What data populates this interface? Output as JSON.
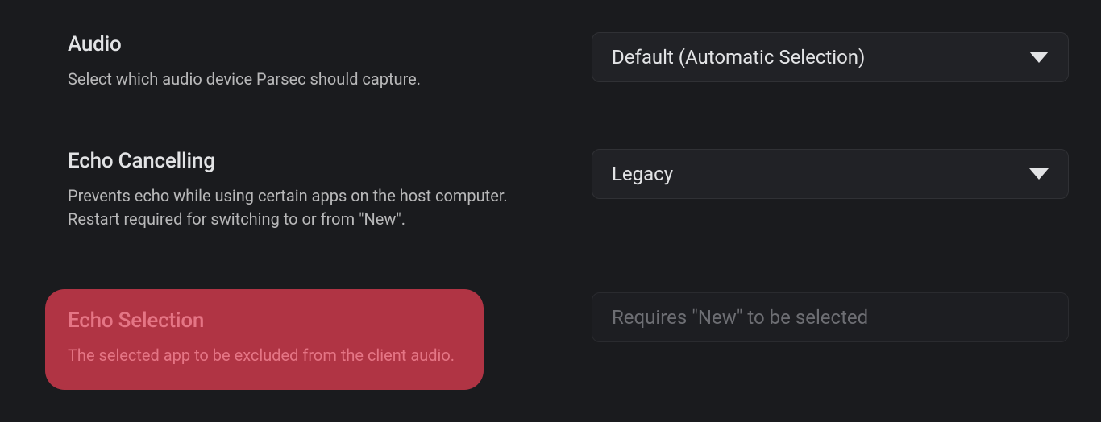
{
  "settings": {
    "audio": {
      "title": "Audio",
      "description": "Select which audio device Parsec should capture.",
      "selected": "Default (Automatic Selection)"
    },
    "echoCancelling": {
      "title": "Echo Cancelling",
      "description": "Prevents echo while using certain apps on the host computer. Restart required for switching to or from \"New\".",
      "selected": "Legacy"
    },
    "echoSelection": {
      "title": "Echo Selection",
      "description": "The selected app to be excluded from the client audio.",
      "placeholder": "Requires \"New\" to be selected"
    }
  }
}
